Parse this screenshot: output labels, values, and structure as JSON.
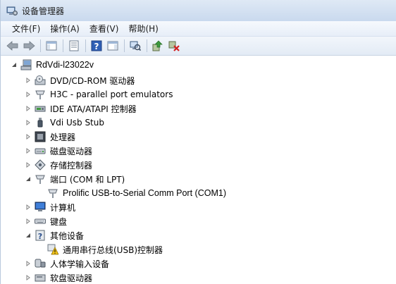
{
  "window": {
    "title": "设备管理器"
  },
  "menu": [
    {
      "label": "文件(F)"
    },
    {
      "label": "操作(A)"
    },
    {
      "label": "查看(V)"
    },
    {
      "label": "帮助(H)"
    }
  ],
  "toolbar": [
    "back-arrow-icon",
    "forward-arrow-icon",
    "show-hide-console-tree-icon",
    "properties-sheet-icon",
    "help-icon",
    "action-pane-icon",
    "scan-hardware-changes-icon",
    "update-driver-icon",
    "uninstall-device-icon"
  ],
  "tree": {
    "root": "RdVdi-l23022v",
    "nodes": [
      {
        "label": "DVD/CD-ROM 驱动器",
        "icon": "cdrom-icon",
        "state": "collapsed"
      },
      {
        "label": "H3C - parallel port emulators",
        "icon": "port-icon",
        "state": "collapsed"
      },
      {
        "label": "IDE ATA/ATAPI 控制器",
        "icon": "ide-controller-icon",
        "state": "collapsed"
      },
      {
        "label": "Vdi Usb Stub",
        "icon": "usb-stub-icon",
        "state": "collapsed"
      },
      {
        "label": "处理器",
        "icon": "processor-icon",
        "state": "collapsed"
      },
      {
        "label": "磁盘驱动器",
        "icon": "disk-drive-icon",
        "state": "collapsed"
      },
      {
        "label": "存储控制器",
        "icon": "storage-controller-icon",
        "state": "collapsed"
      },
      {
        "label": "端口 (COM 和 LPT)",
        "icon": "port-icon",
        "state": "expanded",
        "children": [
          {
            "label": "Prolific USB-to-Serial Comm Port (COM1)",
            "icon": "port-icon"
          }
        ]
      },
      {
        "label": "计算机",
        "icon": "computer-icon",
        "state": "collapsed"
      },
      {
        "label": "键盘",
        "icon": "keyboard-icon",
        "state": "collapsed"
      },
      {
        "label": "其他设备",
        "icon": "unknown-device-icon",
        "state": "expanded",
        "children": [
          {
            "label": "通用串行总线(USB)控制器",
            "icon": "warning-device-icon"
          }
        ]
      },
      {
        "label": "人体学输入设备",
        "icon": "hid-icon",
        "state": "collapsed"
      },
      {
        "label": "软盘驱动器",
        "icon": "floppy-icon",
        "state": "collapsed"
      }
    ]
  }
}
